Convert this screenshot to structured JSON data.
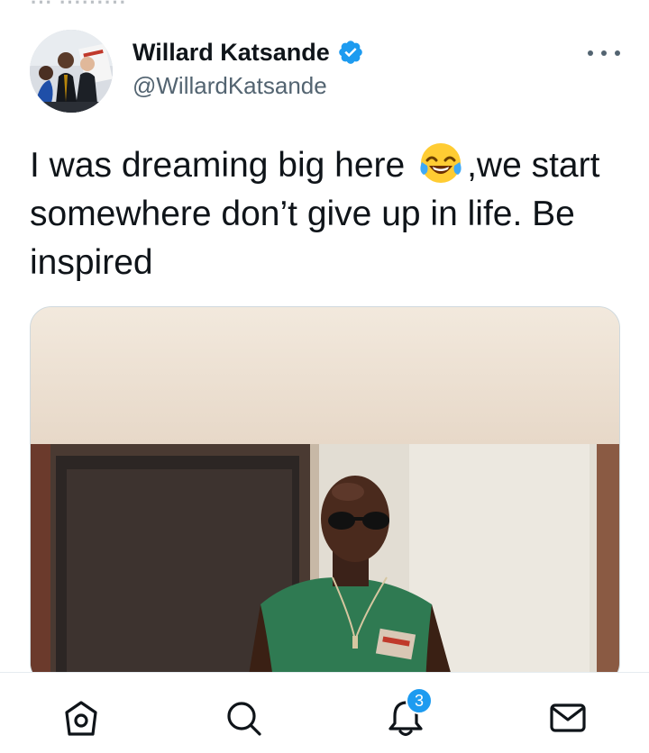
{
  "top_remnant": "··· ·········",
  "author": {
    "name": "Willard Katsande",
    "handle": "@WillardKatsande",
    "verified": true
  },
  "tweet": {
    "text_before_emoji": "I was dreaming big here ",
    "emoji": "face-with-tears-of-joy",
    "text_after_emoji": ",we start somewhere don’t give up in life. Be inspired"
  },
  "bottom_nav": {
    "items": [
      "home-icon",
      "search-icon",
      "notifications-icon",
      "messages-icon"
    ],
    "notifications_badge": "3"
  },
  "colors": {
    "accent": "#1d9bf0",
    "text": "#0f1419",
    "muted": "#536471"
  }
}
